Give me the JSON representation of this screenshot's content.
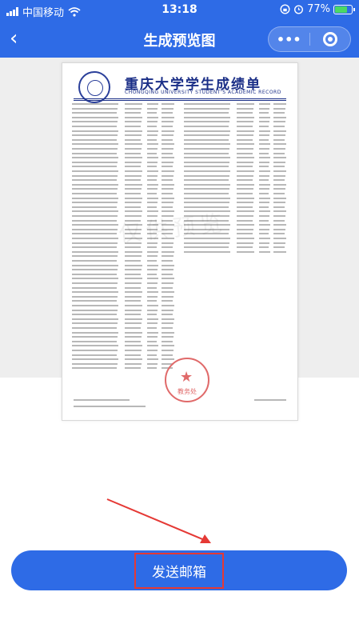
{
  "status_bar": {
    "carrier": "中国移动",
    "time": "13:18",
    "battery_percent": "77%",
    "battery_level": 0.77,
    "icons": [
      "signal-icon",
      "wifi-icon",
      "lock-rotation-icon",
      "alarm-icon",
      "battery-icon"
    ]
  },
  "navbar": {
    "back_icon": "‹",
    "title": "生成预览图",
    "more_icon": "•••",
    "capsule_close_icon": "target-icon"
  },
  "document": {
    "title": "重庆大学学生成绩单",
    "subtitle": "CHONGQING UNIVERSITY STUDENT'S ACADEMIC RECORD",
    "watermark": "仅供预览",
    "seal_text": "教务处"
  },
  "action": {
    "send_label": "发送邮箱"
  },
  "colors": {
    "primary": "#2e6be6",
    "highlight": "#e53935"
  }
}
